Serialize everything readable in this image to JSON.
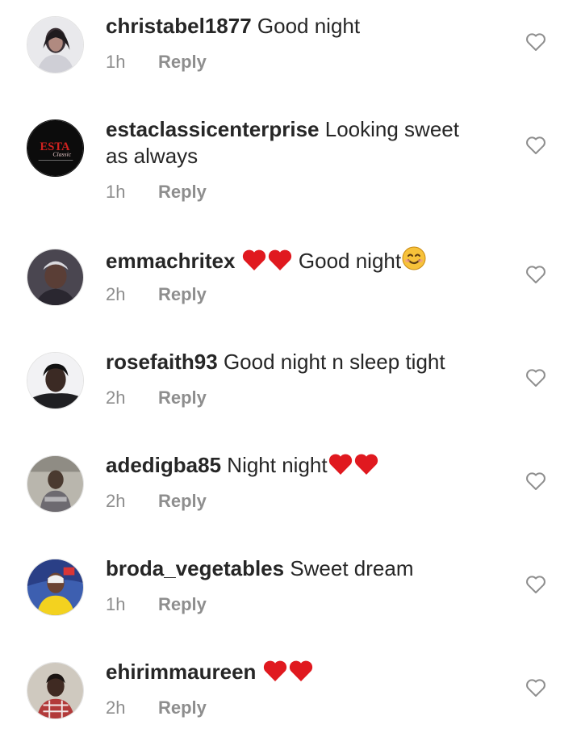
{
  "reply_label": "Reply",
  "colors": {
    "heart_red": "#e0191f",
    "muted": "#8e8e8e",
    "text": "#262626",
    "emoji_yellow": "#f7c23a"
  },
  "comments": [
    {
      "username": "christabel1877",
      "text": " Good night",
      "time": "1h"
    },
    {
      "username": "estaclassicenterprise",
      "text": " Looking sweet as always",
      "time": "1h",
      "avatar_lettering": "ESTA Classic"
    },
    {
      "username": "emmachritex",
      "text": " Good night",
      "time": "2h",
      "emoji_before": [
        "red-heart-icon",
        "red-heart-icon"
      ],
      "emoji_after": [
        "smiling-face-icon"
      ]
    },
    {
      "username": "rosefaith93",
      "text": " Good night n sleep tight",
      "time": "2h"
    },
    {
      "username": "adedigba85",
      "text": " Night night",
      "time": "2h",
      "emoji_after": [
        "red-heart-icon",
        "red-heart-icon"
      ]
    },
    {
      "username": "broda_vegetables",
      "text": " Sweet dream",
      "time": "1h"
    },
    {
      "username": "ehirimmaureen",
      "text": "",
      "time": "2h",
      "emoji_after": [
        "red-heart-icon",
        "red-heart-icon"
      ]
    }
  ]
}
